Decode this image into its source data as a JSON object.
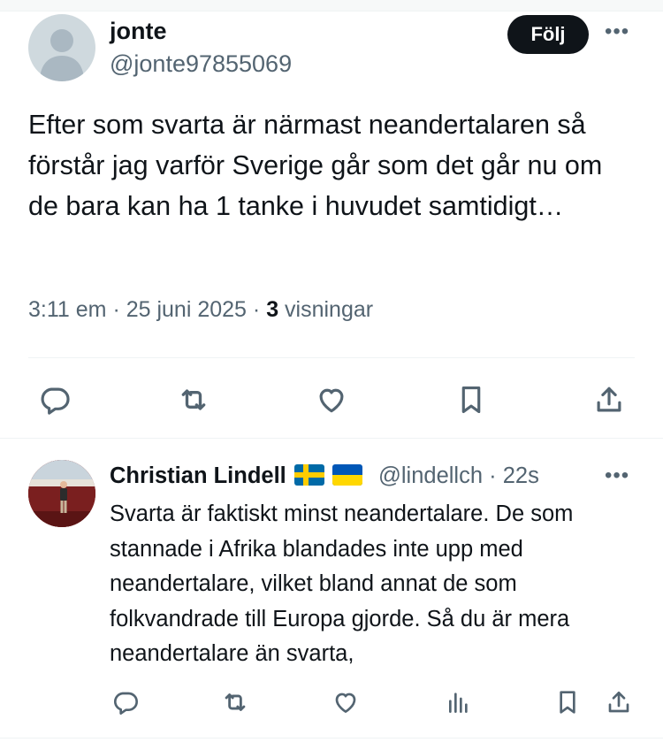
{
  "tweet": {
    "author_name": "jonte",
    "author_handle": "@jonte97855069",
    "follow_label": "Följ",
    "more_label": "•••",
    "text": "Efter som svarta är närmast neandertalaren så förstår jag varför Sverige går som det går nu om de bara kan ha 1 tanke i huvudet samtidigt…",
    "time": "3:11 em",
    "dot": "·",
    "date": "25 juni 2025",
    "views_count": "3",
    "views_label": "visningar",
    "actions": [
      "reply-icon",
      "retweet-icon",
      "like-icon",
      "bookmark-icon",
      "share-icon"
    ]
  },
  "reply": {
    "author_name": "Christian Lindell",
    "flags": [
      "sweden-flag",
      "ukraine-flag"
    ],
    "author_handle": "@lindellch",
    "dot": "·",
    "age": "22s",
    "more_label": "•••",
    "text": "Svarta är faktiskt minst neandertalare. De som stannade i Afrika blandades inte upp med neandertalare, vilket bland annat de som folkvandrade till Europa gjorde.  Så du är mera neandertalare än svarta,",
    "actions": [
      "reply-icon",
      "retweet-icon",
      "like-icon",
      "views-icon",
      "bookmark-icon",
      "share-icon"
    ]
  },
  "colors": {
    "text": "#0f1419",
    "secondary": "#536471",
    "divider": "#eff3f4",
    "button_bg": "#0f1419",
    "sweden_blue": "#006aa7",
    "sweden_yellow": "#fecc00",
    "ukraine_blue": "#0057b7",
    "ukraine_yellow": "#ffd700"
  }
}
